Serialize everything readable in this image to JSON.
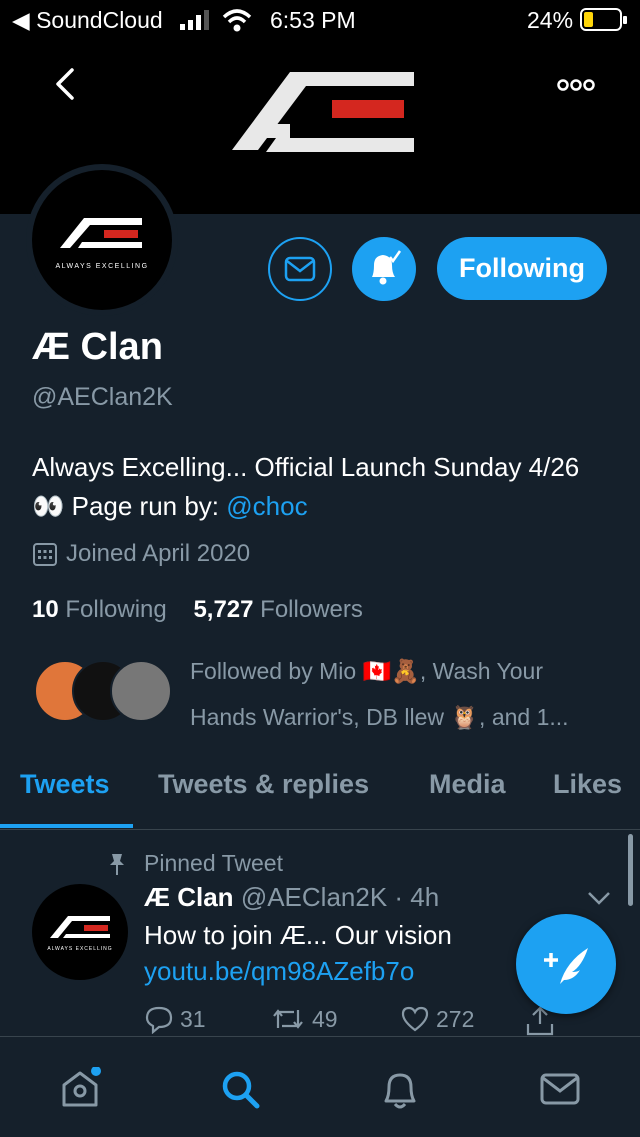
{
  "status_bar": {
    "back_app": "◀ SoundCloud",
    "time": "6:53 PM",
    "battery": "24%"
  },
  "profile": {
    "avatar_tagline": "ALWAYS EXCELLING",
    "follow_label": "Following",
    "name": "Æ Clan",
    "handle": "@AEClan2K",
    "bio_text": "Always Excelling... Official Launch Sunday 4/26 👀 Page run by: ",
    "bio_link": "@choc",
    "joined": "Joined April 2020",
    "following_count": "10",
    "following_label": "Following",
    "followers_count": "5,727",
    "followers_label": "Followers",
    "followed_by": "Followed by Mio 🇨🇦🧸, Wash Your Hands Warrior's, DB llew 🦉, and 1..."
  },
  "tabs": [
    {
      "label": "Tweets"
    },
    {
      "label": "Tweets & replies"
    },
    {
      "label": "Media"
    },
    {
      "label": "Likes"
    }
  ],
  "tweet": {
    "pinned_label": "Pinned Tweet",
    "name": "Æ Clan",
    "handle_time": "@AEClan2K · 4h",
    "text": "How to join Æ... Our vision",
    "link": "youtu.be/qm98AZefb7o",
    "replies": "31",
    "retweets": "49",
    "likes": "272"
  },
  "colors": {
    "accent": "#1da1f2",
    "background": "#15202b",
    "muted": "#8899a6",
    "logo_red": "#d4271f"
  },
  "icons": [
    "back-icon",
    "more-icon",
    "mail-icon",
    "bell-icon",
    "calendar-icon",
    "pin-icon",
    "chevron-down-icon",
    "reply-icon",
    "retweet-icon",
    "like-icon",
    "share-icon",
    "compose-icon",
    "home-icon",
    "search-icon",
    "notifications-icon",
    "messages-icon"
  ]
}
